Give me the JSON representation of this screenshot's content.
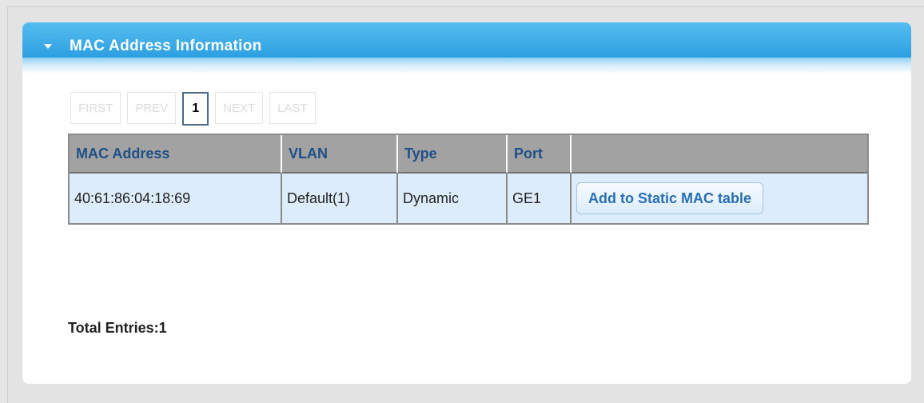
{
  "panel": {
    "title": "MAC Address Information"
  },
  "pager": {
    "first": "FIRST",
    "prev": "PREV",
    "current": "1",
    "next": "NEXT",
    "last": "LAST"
  },
  "table": {
    "columns": [
      "MAC Address",
      "VLAN",
      "Type",
      "Port",
      ""
    ],
    "rows": [
      {
        "mac": "40:61:86:04:18:69",
        "vlan": "Default(1)",
        "type": "Dynamic",
        "port": "GE1",
        "action": "Add to Static MAC table"
      }
    ]
  },
  "footer": {
    "total_entries": "Total Entries:1"
  },
  "colors": {
    "header_blue": "#3aaae7",
    "table_header_text": "#1f4f87",
    "row_bg": "#ddecfb"
  }
}
